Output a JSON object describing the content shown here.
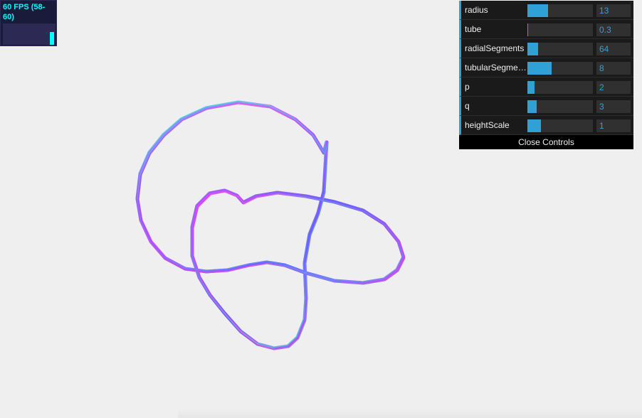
{
  "stats": {
    "fps_text": "60 FPS (58-60)",
    "fps_bar_fraction": 0.55,
    "text_color": "#00ffff",
    "background": "#1a1a3a"
  },
  "gui": {
    "accent_color": "#2fa1d6",
    "controls": [
      {
        "label": "radius",
        "value": "13",
        "fill_fraction": 0.32
      },
      {
        "label": "tube",
        "value": "0.3",
        "fill_fraction": 0.01
      },
      {
        "label": "radialSegments",
        "value": "64",
        "fill_fraction": 0.16
      },
      {
        "label": "tubularSegme…",
        "value": "8",
        "fill_fraction": 0.37
      },
      {
        "label": "p",
        "value": "2",
        "fill_fraction": 0.11
      },
      {
        "label": "q",
        "value": "3",
        "fill_fraction": 0.14
      },
      {
        "label": "heightScale",
        "value": "1",
        "fill_fraction": 0.21
      }
    ],
    "close_label": "Close Controls"
  },
  "scene": {
    "background": "#efefef",
    "object": "torus-knot",
    "material": "normal"
  }
}
